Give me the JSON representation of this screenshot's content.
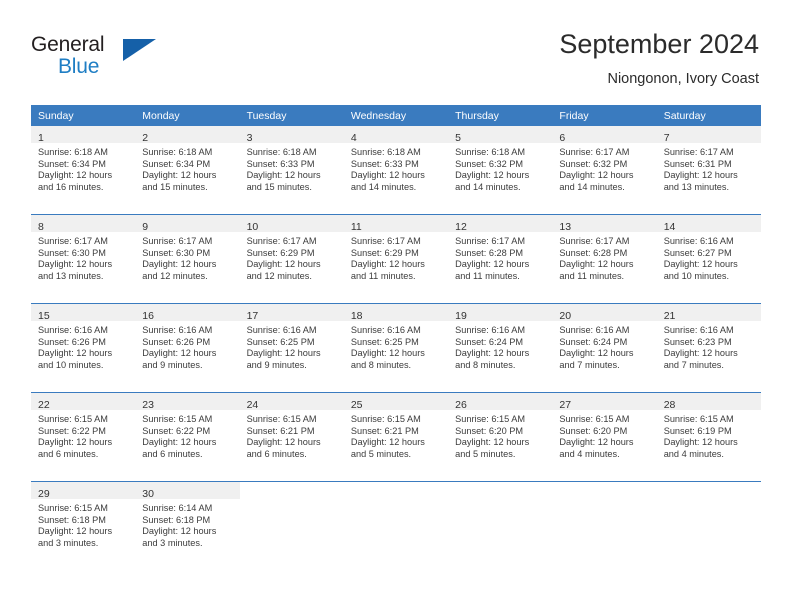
{
  "brand": {
    "word_one": "General",
    "word_two": "Blue",
    "accent_color": "#1560a8",
    "blue_text_color": "#1f7ec4"
  },
  "header": {
    "title": "September 2024",
    "subtitle": "Niongonon, Ivory Coast"
  },
  "theme": {
    "header_row_color": "#3a7bbf",
    "daynum_band_color": "#f0f0f0",
    "text_color": "#3c3c3c"
  },
  "labels": {
    "sunrise_prefix": "Sunrise:",
    "sunset_prefix": "Sunset:",
    "daylight_prefix": "Daylight:"
  },
  "weekday_headers": [
    "Sunday",
    "Monday",
    "Tuesday",
    "Wednesday",
    "Thursday",
    "Friday",
    "Saturday"
  ],
  "weeks": [
    [
      {
        "day": "1",
        "sunrise": "Sunrise: 6:18 AM",
        "sunset": "Sunset: 6:34 PM",
        "daylight_1": "Daylight: 12 hours",
        "daylight_2": "and 16 minutes."
      },
      {
        "day": "2",
        "sunrise": "Sunrise: 6:18 AM",
        "sunset": "Sunset: 6:34 PM",
        "daylight_1": "Daylight: 12 hours",
        "daylight_2": "and 15 minutes."
      },
      {
        "day": "3",
        "sunrise": "Sunrise: 6:18 AM",
        "sunset": "Sunset: 6:33 PM",
        "daylight_1": "Daylight: 12 hours",
        "daylight_2": "and 15 minutes."
      },
      {
        "day": "4",
        "sunrise": "Sunrise: 6:18 AM",
        "sunset": "Sunset: 6:33 PM",
        "daylight_1": "Daylight: 12 hours",
        "daylight_2": "and 14 minutes."
      },
      {
        "day": "5",
        "sunrise": "Sunrise: 6:18 AM",
        "sunset": "Sunset: 6:32 PM",
        "daylight_1": "Daylight: 12 hours",
        "daylight_2": "and 14 minutes."
      },
      {
        "day": "6",
        "sunrise": "Sunrise: 6:17 AM",
        "sunset": "Sunset: 6:32 PM",
        "daylight_1": "Daylight: 12 hours",
        "daylight_2": "and 14 minutes."
      },
      {
        "day": "7",
        "sunrise": "Sunrise: 6:17 AM",
        "sunset": "Sunset: 6:31 PM",
        "daylight_1": "Daylight: 12 hours",
        "daylight_2": "and 13 minutes."
      }
    ],
    [
      {
        "day": "8",
        "sunrise": "Sunrise: 6:17 AM",
        "sunset": "Sunset: 6:30 PM",
        "daylight_1": "Daylight: 12 hours",
        "daylight_2": "and 13 minutes."
      },
      {
        "day": "9",
        "sunrise": "Sunrise: 6:17 AM",
        "sunset": "Sunset: 6:30 PM",
        "daylight_1": "Daylight: 12 hours",
        "daylight_2": "and 12 minutes."
      },
      {
        "day": "10",
        "sunrise": "Sunrise: 6:17 AM",
        "sunset": "Sunset: 6:29 PM",
        "daylight_1": "Daylight: 12 hours",
        "daylight_2": "and 12 minutes."
      },
      {
        "day": "11",
        "sunrise": "Sunrise: 6:17 AM",
        "sunset": "Sunset: 6:29 PM",
        "daylight_1": "Daylight: 12 hours",
        "daylight_2": "and 11 minutes."
      },
      {
        "day": "12",
        "sunrise": "Sunrise: 6:17 AM",
        "sunset": "Sunset: 6:28 PM",
        "daylight_1": "Daylight: 12 hours",
        "daylight_2": "and 11 minutes."
      },
      {
        "day": "13",
        "sunrise": "Sunrise: 6:17 AM",
        "sunset": "Sunset: 6:28 PM",
        "daylight_1": "Daylight: 12 hours",
        "daylight_2": "and 11 minutes."
      },
      {
        "day": "14",
        "sunrise": "Sunrise: 6:16 AM",
        "sunset": "Sunset: 6:27 PM",
        "daylight_1": "Daylight: 12 hours",
        "daylight_2": "and 10 minutes."
      }
    ],
    [
      {
        "day": "15",
        "sunrise": "Sunrise: 6:16 AM",
        "sunset": "Sunset: 6:26 PM",
        "daylight_1": "Daylight: 12 hours",
        "daylight_2": "and 10 minutes."
      },
      {
        "day": "16",
        "sunrise": "Sunrise: 6:16 AM",
        "sunset": "Sunset: 6:26 PM",
        "daylight_1": "Daylight: 12 hours",
        "daylight_2": "and 9 minutes."
      },
      {
        "day": "17",
        "sunrise": "Sunrise: 6:16 AM",
        "sunset": "Sunset: 6:25 PM",
        "daylight_1": "Daylight: 12 hours",
        "daylight_2": "and 9 minutes."
      },
      {
        "day": "18",
        "sunrise": "Sunrise: 6:16 AM",
        "sunset": "Sunset: 6:25 PM",
        "daylight_1": "Daylight: 12 hours",
        "daylight_2": "and 8 minutes."
      },
      {
        "day": "19",
        "sunrise": "Sunrise: 6:16 AM",
        "sunset": "Sunset: 6:24 PM",
        "daylight_1": "Daylight: 12 hours",
        "daylight_2": "and 8 minutes."
      },
      {
        "day": "20",
        "sunrise": "Sunrise: 6:16 AM",
        "sunset": "Sunset: 6:24 PM",
        "daylight_1": "Daylight: 12 hours",
        "daylight_2": "and 7 minutes."
      },
      {
        "day": "21",
        "sunrise": "Sunrise: 6:16 AM",
        "sunset": "Sunset: 6:23 PM",
        "daylight_1": "Daylight: 12 hours",
        "daylight_2": "and 7 minutes."
      }
    ],
    [
      {
        "day": "22",
        "sunrise": "Sunrise: 6:15 AM",
        "sunset": "Sunset: 6:22 PM",
        "daylight_1": "Daylight: 12 hours",
        "daylight_2": "and 6 minutes."
      },
      {
        "day": "23",
        "sunrise": "Sunrise: 6:15 AM",
        "sunset": "Sunset: 6:22 PM",
        "daylight_1": "Daylight: 12 hours",
        "daylight_2": "and 6 minutes."
      },
      {
        "day": "24",
        "sunrise": "Sunrise: 6:15 AM",
        "sunset": "Sunset: 6:21 PM",
        "daylight_1": "Daylight: 12 hours",
        "daylight_2": "and 6 minutes."
      },
      {
        "day": "25",
        "sunrise": "Sunrise: 6:15 AM",
        "sunset": "Sunset: 6:21 PM",
        "daylight_1": "Daylight: 12 hours",
        "daylight_2": "and 5 minutes."
      },
      {
        "day": "26",
        "sunrise": "Sunrise: 6:15 AM",
        "sunset": "Sunset: 6:20 PM",
        "daylight_1": "Daylight: 12 hours",
        "daylight_2": "and 5 minutes."
      },
      {
        "day": "27",
        "sunrise": "Sunrise: 6:15 AM",
        "sunset": "Sunset: 6:20 PM",
        "daylight_1": "Daylight: 12 hours",
        "daylight_2": "and 4 minutes."
      },
      {
        "day": "28",
        "sunrise": "Sunrise: 6:15 AM",
        "sunset": "Sunset: 6:19 PM",
        "daylight_1": "Daylight: 12 hours",
        "daylight_2": "and 4 minutes."
      }
    ],
    [
      {
        "day": "29",
        "sunrise": "Sunrise: 6:15 AM",
        "sunset": "Sunset: 6:18 PM",
        "daylight_1": "Daylight: 12 hours",
        "daylight_2": "and 3 minutes."
      },
      {
        "day": "30",
        "sunrise": "Sunrise: 6:14 AM",
        "sunset": "Sunset: 6:18 PM",
        "daylight_1": "Daylight: 12 hours",
        "daylight_2": "and 3 minutes."
      },
      {
        "day": "",
        "sunrise": "",
        "sunset": "",
        "daylight_1": "",
        "daylight_2": ""
      },
      {
        "day": "",
        "sunrise": "",
        "sunset": "",
        "daylight_1": "",
        "daylight_2": ""
      },
      {
        "day": "",
        "sunrise": "",
        "sunset": "",
        "daylight_1": "",
        "daylight_2": ""
      },
      {
        "day": "",
        "sunrise": "",
        "sunset": "",
        "daylight_1": "",
        "daylight_2": ""
      },
      {
        "day": "",
        "sunrise": "",
        "sunset": "",
        "daylight_1": "",
        "daylight_2": ""
      }
    ]
  ]
}
